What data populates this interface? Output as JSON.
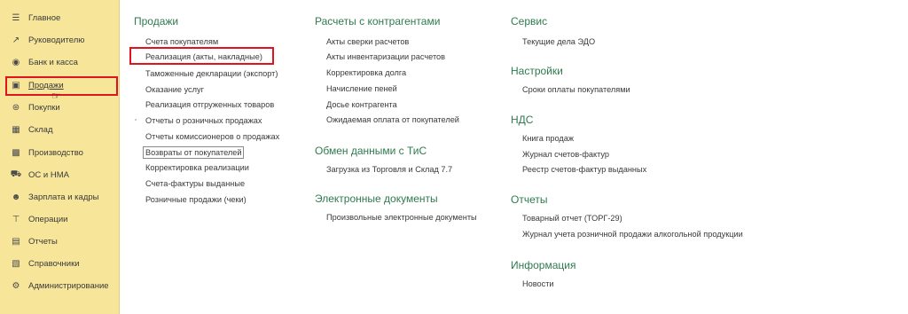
{
  "sidebar": {
    "items": [
      {
        "label": "Главное",
        "icon": "menu-icon"
      },
      {
        "label": "Руководителю",
        "icon": "trend-icon"
      },
      {
        "label": "Банк и касса",
        "icon": "coin-icon"
      },
      {
        "label": "Продажи",
        "icon": "bag-icon"
      },
      {
        "label": "Покупки",
        "icon": "cart-icon"
      },
      {
        "label": "Склад",
        "icon": "warehouse-icon"
      },
      {
        "label": "Производство",
        "icon": "factory-icon"
      },
      {
        "label": "ОС и НМА",
        "icon": "truck-icon"
      },
      {
        "label": "Зарплата и кадры",
        "icon": "people-icon"
      },
      {
        "label": "Операции",
        "icon": "operations-icon"
      },
      {
        "label": "Отчеты",
        "icon": "reports-icon"
      },
      {
        "label": "Справочники",
        "icon": "books-icon"
      },
      {
        "label": "Администрирование",
        "icon": "gear-icon"
      }
    ]
  },
  "columns": {
    "sales": {
      "title": "Продажи",
      "links": [
        "Счета покупателям",
        "Реализация (акты, накладные)",
        "Таможенные декларации (экспорт)",
        "Оказание услуг",
        "Реализация отгруженных товаров",
        "Отчеты о розничных продажах",
        "Отчеты комиссионеров о продажах",
        "Возвраты от покупателей",
        "Корректировка реализации",
        "Счета-фактуры выданные",
        "Розничные продажи (чеки)"
      ]
    },
    "settlements": {
      "title": "Расчеты с контрагентами",
      "links": [
        "Акты сверки расчетов",
        "Акты инвентаризации расчетов",
        "Корректировка долга",
        "Начисление пеней",
        "Досье контрагента",
        "Ожидаемая оплата от покупателей"
      ]
    },
    "exchange": {
      "title": "Обмен данными с ТиС",
      "links": [
        "Загрузка из Торговля и Склад 7.7"
      ]
    },
    "edocs": {
      "title": "Электронные документы",
      "links": [
        "Произвольные электронные документы"
      ]
    },
    "service": {
      "title": "Сервис",
      "links": [
        "Текущие дела ЭДО"
      ]
    },
    "settings": {
      "title": "Настройки",
      "links": [
        "Сроки оплаты покупателями"
      ]
    },
    "vat": {
      "title": "НДС",
      "links": [
        "Книга продаж",
        "Журнал счетов-фактур",
        "Реестр счетов-фактур выданных"
      ]
    },
    "reports": {
      "title": "Отчеты",
      "links": [
        "Товарный отчет (ТОРГ-29)",
        "Журнал учета розничной продажи алкогольной продукции"
      ]
    },
    "info": {
      "title": "Информация",
      "links": [
        "Новости"
      ]
    }
  }
}
